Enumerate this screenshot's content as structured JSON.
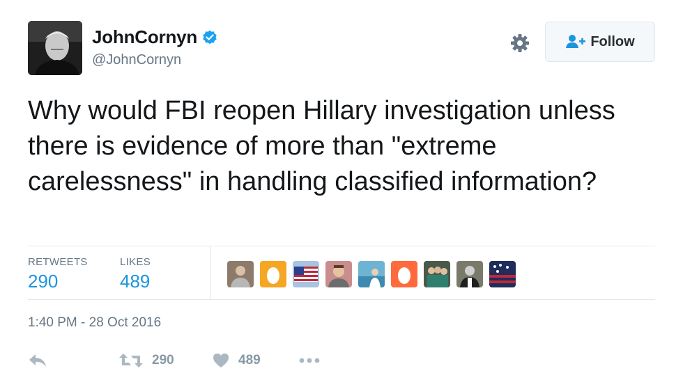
{
  "user": {
    "display_name": "JohnCornyn",
    "handle": "@JohnCornyn",
    "verified_icon": "verified-badge-icon",
    "avatar_icon": "user-avatar"
  },
  "header": {
    "settings_icon": "gear-icon",
    "follow_label": "Follow",
    "follow_icon": "add-user-icon"
  },
  "tweet": {
    "text": "Why would FBI reopen Hillary investigation unless there is evidence of more than \"extreme carelessness\" in handling classified information?"
  },
  "stats": {
    "retweets_label": "RETWEETS",
    "retweets_value": "290",
    "likes_label": "LIKES",
    "likes_value": "489"
  },
  "liker_avatars": [
    {
      "icon": "person-avatar"
    },
    {
      "icon": "default-egg-avatar"
    },
    {
      "icon": "flag-avatar"
    },
    {
      "icon": "person-avatar"
    },
    {
      "icon": "landscape-avatar"
    },
    {
      "icon": "default-egg-avatar"
    },
    {
      "icon": "group-avatar"
    },
    {
      "icon": "person-avatar"
    },
    {
      "icon": "flag-avatar"
    }
  ],
  "timestamp": "1:40 PM - 28 Oct 2016",
  "actions": {
    "reply_icon": "reply-icon",
    "retweet_icon": "retweet-icon",
    "retweet_count": "290",
    "like_icon": "heart-icon",
    "like_count": "489",
    "more_icon": "more-icon"
  },
  "colors": {
    "accent": "#1b95e0",
    "verified": "#1da1f2",
    "muted": "#657786",
    "action": "#aab8c2",
    "border": "#e1e8ed",
    "egg": "#f5a623",
    "egg_alt": "#ff6a3d"
  }
}
